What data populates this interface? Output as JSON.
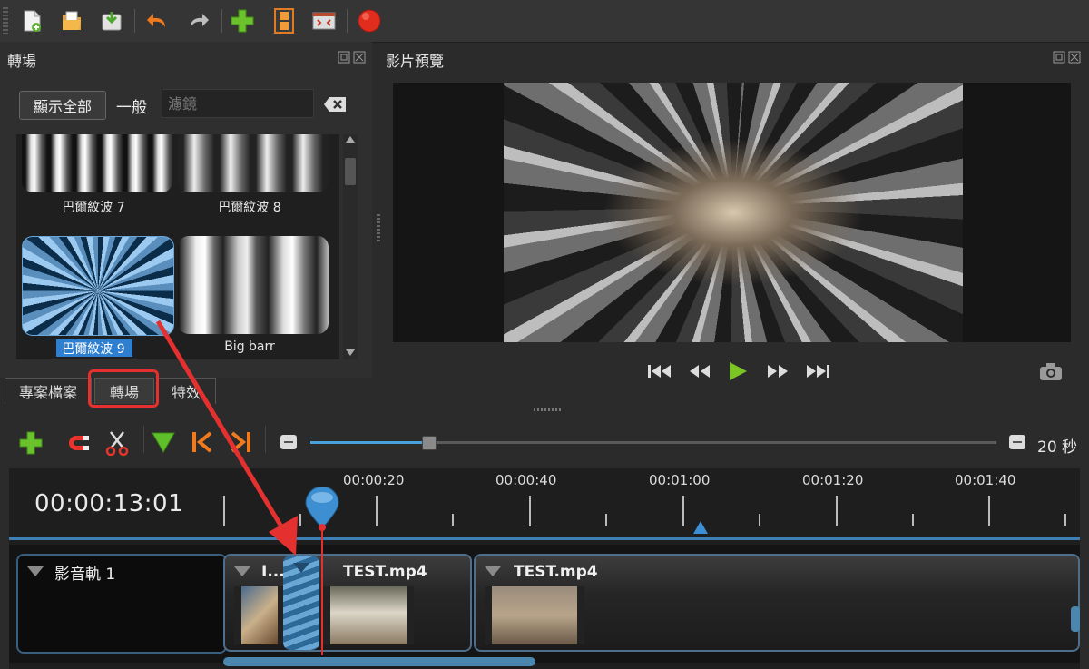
{
  "toolbar": {
    "icons": [
      "new-file-icon",
      "open-project-icon",
      "save-project-icon",
      "undo-icon",
      "redo-icon",
      "add-icon",
      "film-strip-icon",
      "fullscreen-icon",
      "record-icon"
    ]
  },
  "left_panel": {
    "title": "轉場",
    "show_all_label": "顯示全部",
    "general_label": "一般",
    "filter_placeholder": "濾鏡",
    "items": [
      {
        "label": "巴爾紋波 7",
        "selected": false
      },
      {
        "label": "巴爾紋波 8",
        "selected": false
      },
      {
        "label": "巴爾紋波 9",
        "selected": true
      },
      {
        "label": "Big barr",
        "selected": false
      }
    ]
  },
  "tabs": [
    {
      "label": "專案檔案",
      "active": false
    },
    {
      "label": "轉場",
      "active": true
    },
    {
      "label": "特效",
      "active": false
    }
  ],
  "preview": {
    "title": "影片預覽"
  },
  "timeline": {
    "zoom_label": "20 秒",
    "timecode": "00:00:13:01",
    "ruler_labels": [
      "00:00:20",
      "00:00:40",
      "00:01:00",
      "00:01:20",
      "00:01:40"
    ],
    "track_name": "影音軌 1",
    "clips": [
      {
        "title": "I..."
      },
      {
        "title": "TEST.mp4"
      },
      {
        "title": "TEST.mp4"
      }
    ]
  },
  "colors": {
    "annotation_red": "#e53030",
    "accent_blue": "#3d8fd1",
    "selected_label_bg": "#2f7fd0"
  }
}
